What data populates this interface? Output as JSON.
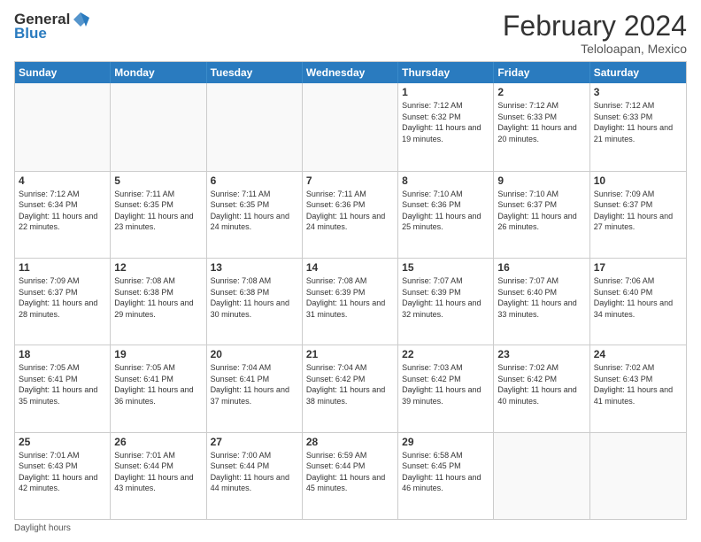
{
  "header": {
    "logo_general": "General",
    "logo_blue": "Blue",
    "title": "February 2024",
    "subtitle": "Teloloapan, Mexico"
  },
  "days_of_week": [
    "Sunday",
    "Monday",
    "Tuesday",
    "Wednesday",
    "Thursday",
    "Friday",
    "Saturday"
  ],
  "weeks": [
    [
      {
        "num": "",
        "info": "",
        "empty": true
      },
      {
        "num": "",
        "info": "",
        "empty": true
      },
      {
        "num": "",
        "info": "",
        "empty": true
      },
      {
        "num": "",
        "info": "",
        "empty": true
      },
      {
        "num": "1",
        "info": "Sunrise: 7:12 AM\nSunset: 6:32 PM\nDaylight: 11 hours and 19 minutes.",
        "empty": false
      },
      {
        "num": "2",
        "info": "Sunrise: 7:12 AM\nSunset: 6:33 PM\nDaylight: 11 hours and 20 minutes.",
        "empty": false
      },
      {
        "num": "3",
        "info": "Sunrise: 7:12 AM\nSunset: 6:33 PM\nDaylight: 11 hours and 21 minutes.",
        "empty": false
      }
    ],
    [
      {
        "num": "4",
        "info": "Sunrise: 7:12 AM\nSunset: 6:34 PM\nDaylight: 11 hours and 22 minutes.",
        "empty": false
      },
      {
        "num": "5",
        "info": "Sunrise: 7:11 AM\nSunset: 6:35 PM\nDaylight: 11 hours and 23 minutes.",
        "empty": false
      },
      {
        "num": "6",
        "info": "Sunrise: 7:11 AM\nSunset: 6:35 PM\nDaylight: 11 hours and 24 minutes.",
        "empty": false
      },
      {
        "num": "7",
        "info": "Sunrise: 7:11 AM\nSunset: 6:36 PM\nDaylight: 11 hours and 24 minutes.",
        "empty": false
      },
      {
        "num": "8",
        "info": "Sunrise: 7:10 AM\nSunset: 6:36 PM\nDaylight: 11 hours and 25 minutes.",
        "empty": false
      },
      {
        "num": "9",
        "info": "Sunrise: 7:10 AM\nSunset: 6:37 PM\nDaylight: 11 hours and 26 minutes.",
        "empty": false
      },
      {
        "num": "10",
        "info": "Sunrise: 7:09 AM\nSunset: 6:37 PM\nDaylight: 11 hours and 27 minutes.",
        "empty": false
      }
    ],
    [
      {
        "num": "11",
        "info": "Sunrise: 7:09 AM\nSunset: 6:37 PM\nDaylight: 11 hours and 28 minutes.",
        "empty": false
      },
      {
        "num": "12",
        "info": "Sunrise: 7:08 AM\nSunset: 6:38 PM\nDaylight: 11 hours and 29 minutes.",
        "empty": false
      },
      {
        "num": "13",
        "info": "Sunrise: 7:08 AM\nSunset: 6:38 PM\nDaylight: 11 hours and 30 minutes.",
        "empty": false
      },
      {
        "num": "14",
        "info": "Sunrise: 7:08 AM\nSunset: 6:39 PM\nDaylight: 11 hours and 31 minutes.",
        "empty": false
      },
      {
        "num": "15",
        "info": "Sunrise: 7:07 AM\nSunset: 6:39 PM\nDaylight: 11 hours and 32 minutes.",
        "empty": false
      },
      {
        "num": "16",
        "info": "Sunrise: 7:07 AM\nSunset: 6:40 PM\nDaylight: 11 hours and 33 minutes.",
        "empty": false
      },
      {
        "num": "17",
        "info": "Sunrise: 7:06 AM\nSunset: 6:40 PM\nDaylight: 11 hours and 34 minutes.",
        "empty": false
      }
    ],
    [
      {
        "num": "18",
        "info": "Sunrise: 7:05 AM\nSunset: 6:41 PM\nDaylight: 11 hours and 35 minutes.",
        "empty": false
      },
      {
        "num": "19",
        "info": "Sunrise: 7:05 AM\nSunset: 6:41 PM\nDaylight: 11 hours and 36 minutes.",
        "empty": false
      },
      {
        "num": "20",
        "info": "Sunrise: 7:04 AM\nSunset: 6:41 PM\nDaylight: 11 hours and 37 minutes.",
        "empty": false
      },
      {
        "num": "21",
        "info": "Sunrise: 7:04 AM\nSunset: 6:42 PM\nDaylight: 11 hours and 38 minutes.",
        "empty": false
      },
      {
        "num": "22",
        "info": "Sunrise: 7:03 AM\nSunset: 6:42 PM\nDaylight: 11 hours and 39 minutes.",
        "empty": false
      },
      {
        "num": "23",
        "info": "Sunrise: 7:02 AM\nSunset: 6:42 PM\nDaylight: 11 hours and 40 minutes.",
        "empty": false
      },
      {
        "num": "24",
        "info": "Sunrise: 7:02 AM\nSunset: 6:43 PM\nDaylight: 11 hours and 41 minutes.",
        "empty": false
      }
    ],
    [
      {
        "num": "25",
        "info": "Sunrise: 7:01 AM\nSunset: 6:43 PM\nDaylight: 11 hours and 42 minutes.",
        "empty": false
      },
      {
        "num": "26",
        "info": "Sunrise: 7:01 AM\nSunset: 6:44 PM\nDaylight: 11 hours and 43 minutes.",
        "empty": false
      },
      {
        "num": "27",
        "info": "Sunrise: 7:00 AM\nSunset: 6:44 PM\nDaylight: 11 hours and 44 minutes.",
        "empty": false
      },
      {
        "num": "28",
        "info": "Sunrise: 6:59 AM\nSunset: 6:44 PM\nDaylight: 11 hours and 45 minutes.",
        "empty": false
      },
      {
        "num": "29",
        "info": "Sunrise: 6:58 AM\nSunset: 6:45 PM\nDaylight: 11 hours and 46 minutes.",
        "empty": false
      },
      {
        "num": "",
        "info": "",
        "empty": true
      },
      {
        "num": "",
        "info": "",
        "empty": true
      }
    ]
  ],
  "footer": {
    "text": "Daylight hours"
  }
}
